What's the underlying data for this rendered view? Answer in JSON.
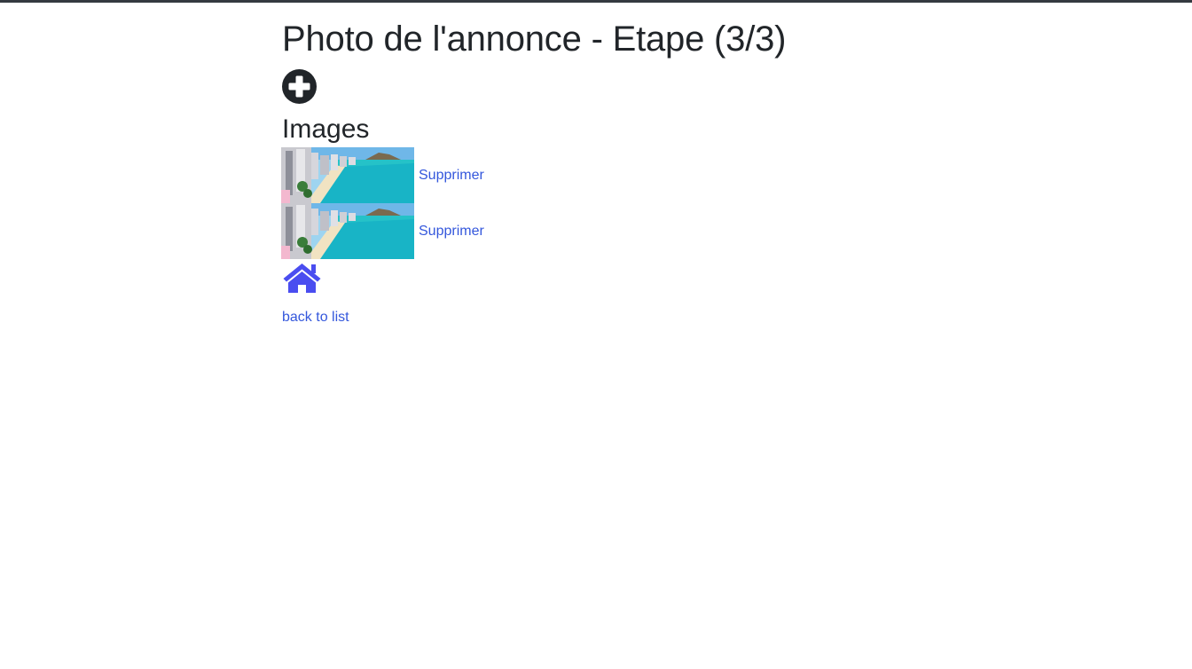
{
  "header": {
    "title": "Photo de l'annonce - Etape (3/3)",
    "add_icon": "plus-circle-icon"
  },
  "images_section": {
    "title": "Images",
    "items": [
      {
        "image_icon": "beach-photo",
        "delete_label": "Supprimer"
      },
      {
        "image_icon": "beach-photo",
        "delete_label": "Supprimer"
      }
    ]
  },
  "footer": {
    "home_icon": "home-icon",
    "back_label": "back to list"
  },
  "colors": {
    "text": "#212529",
    "link": "#3457dc",
    "home_icon": "#4a4df0",
    "top_bar": "#343a40"
  }
}
